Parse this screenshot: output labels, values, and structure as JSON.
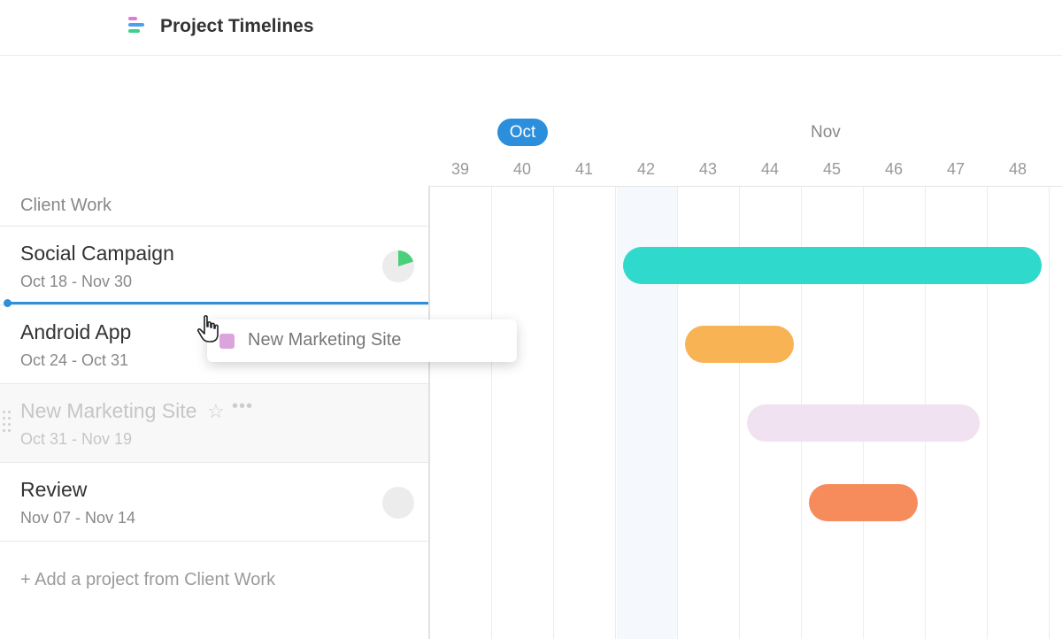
{
  "header": {
    "title": "Project Timelines"
  },
  "timeline": {
    "months": [
      {
        "label": "Oct",
        "current": true
      },
      {
        "label": "Nov",
        "current": false
      }
    ],
    "weeks": [
      "39",
      "40",
      "41",
      "42",
      "43",
      "44",
      "45",
      "46",
      "47",
      "48"
    ],
    "current_week": "42"
  },
  "group": {
    "title": "Client Work",
    "add_label": "+ Add a project from Client Work"
  },
  "projects": [
    {
      "name": "Social Campaign",
      "dates": "Oct 18 - Nov 30",
      "color": "#2fd9cb",
      "progress_fraction": 0.2
    },
    {
      "name": "Android App",
      "dates": "Oct 24 - Oct 31",
      "color": "#f7b354"
    },
    {
      "name": "New Marketing Site",
      "dates": "Oct 31 - Nov 19",
      "color": "#f1e2f2",
      "dragging": true
    },
    {
      "name": "Review",
      "dates": "Nov 07 - Nov 14",
      "color": "#f68b5b",
      "progress_fraction": 0
    }
  ],
  "drag_preview": {
    "label": "New Marketing Site",
    "color": "#dca4dc"
  },
  "colors": {
    "accent": "#2b8fdc",
    "progress_fill": "#4ccf7a"
  }
}
